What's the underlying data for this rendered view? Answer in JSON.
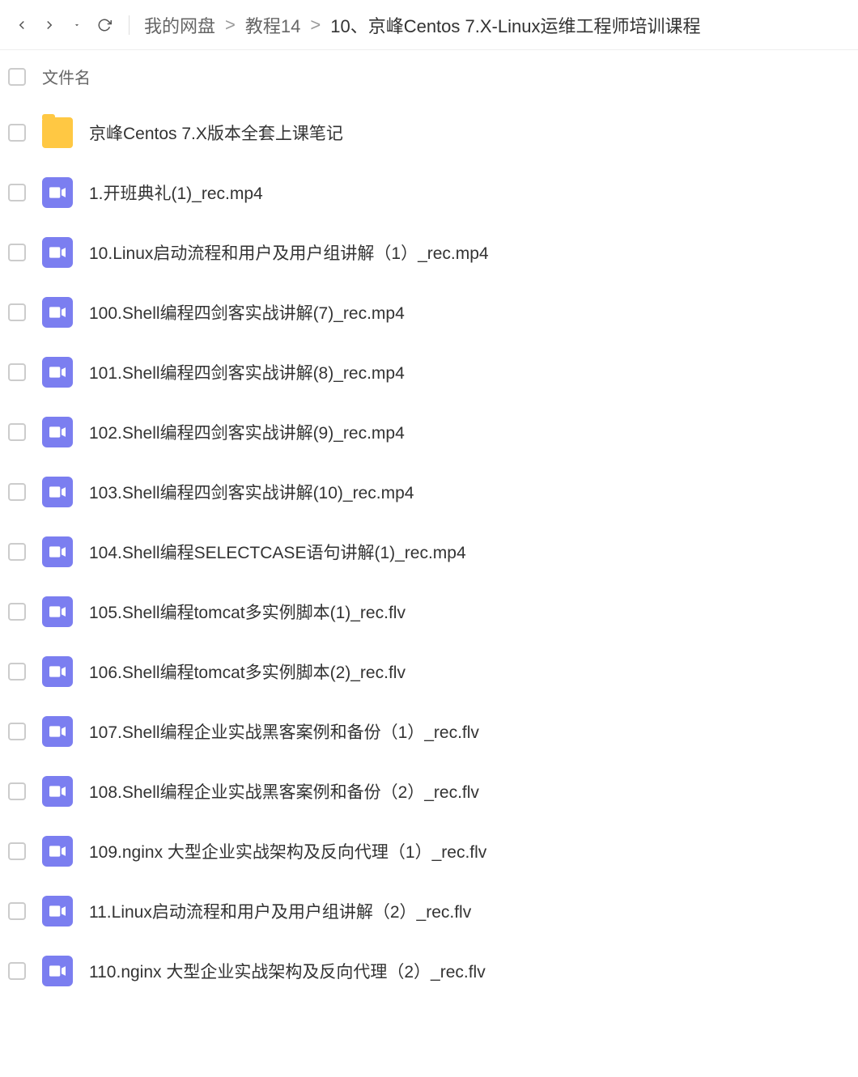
{
  "breadcrumb": {
    "items": [
      {
        "label": "我的网盘"
      },
      {
        "label": "教程14"
      },
      {
        "label": "10、京峰Centos 7.X-Linux运维工程师培训课程"
      }
    ],
    "separator": ">"
  },
  "header": {
    "filename_label": "文件名"
  },
  "files": [
    {
      "type": "folder",
      "name": "京峰Centos 7.X版本全套上课笔记"
    },
    {
      "type": "video",
      "name": "1.开班典礼(1)_rec.mp4"
    },
    {
      "type": "video",
      "name": "10.Linux启动流程和用户及用户组讲解（1）_rec.mp4"
    },
    {
      "type": "video",
      "name": "100.Shell编程四剑客实战讲解(7)_rec.mp4"
    },
    {
      "type": "video",
      "name": "101.Shell编程四剑客实战讲解(8)_rec.mp4"
    },
    {
      "type": "video",
      "name": "102.Shell编程四剑客实战讲解(9)_rec.mp4"
    },
    {
      "type": "video",
      "name": "103.Shell编程四剑客实战讲解(10)_rec.mp4"
    },
    {
      "type": "video",
      "name": "104.Shell编程SELECTCASE语句讲解(1)_rec.mp4"
    },
    {
      "type": "video",
      "name": "105.Shell编程tomcat多实例脚本(1)_rec.flv"
    },
    {
      "type": "video",
      "name": "106.Shell编程tomcat多实例脚本(2)_rec.flv"
    },
    {
      "type": "video",
      "name": "107.Shell编程企业实战黑客案例和备份（1）_rec.flv"
    },
    {
      "type": "video",
      "name": "108.Shell编程企业实战黑客案例和备份（2）_rec.flv"
    },
    {
      "type": "video",
      "name": "109.nginx 大型企业实战架构及反向代理（1）_rec.flv"
    },
    {
      "type": "video",
      "name": "11.Linux启动流程和用户及用户组讲解（2）_rec.flv"
    },
    {
      "type": "video",
      "name": "110.nginx 大型企业实战架构及反向代理（2）_rec.flv"
    }
  ]
}
